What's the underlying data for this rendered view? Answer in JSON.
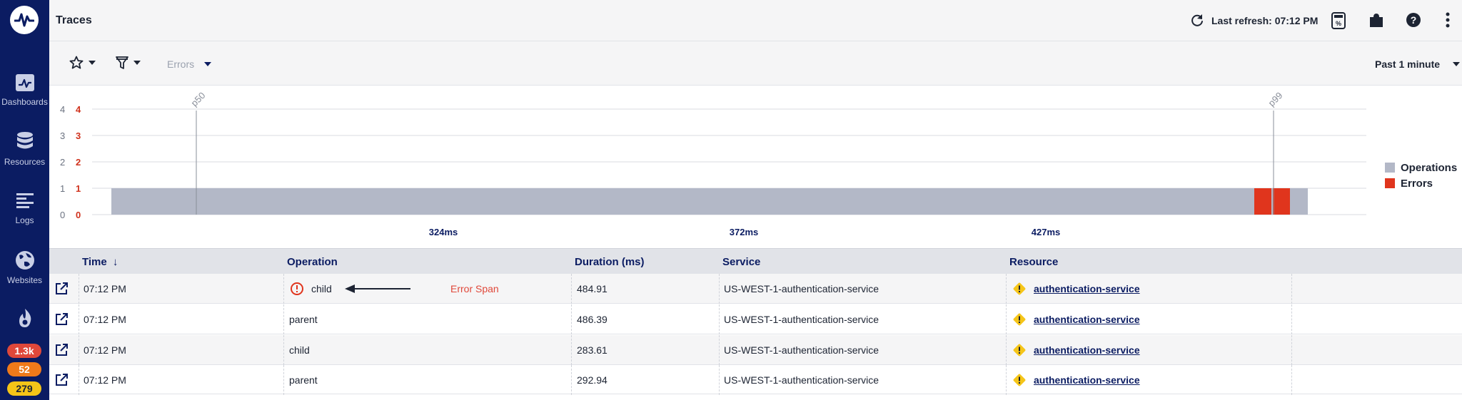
{
  "sidebar": {
    "items": [
      {
        "label": "Dashboards",
        "icon": "dashboard-icon"
      },
      {
        "label": "Resources",
        "icon": "database-icon"
      },
      {
        "label": "Logs",
        "icon": "logs-icon"
      },
      {
        "label": "Websites",
        "icon": "globe-icon"
      }
    ],
    "badges": [
      "1.3k",
      "52",
      "279"
    ]
  },
  "header": {
    "title": "Traces",
    "last_refresh": "Last refresh: 07:12 PM"
  },
  "toolbar": {
    "errors_placeholder": "Errors",
    "time_range": "Past 1 minute"
  },
  "colors": {
    "operations": "#b3b8c7",
    "errors": "#e0351d",
    "brand": "#0b1c62"
  },
  "chart_data": {
    "type": "bar",
    "series": [
      {
        "name": "Operations",
        "y_axis": "left"
      },
      {
        "name": "Errors",
        "y_axis": "right"
      }
    ],
    "y_ticks_left": [
      "0",
      "1",
      "2",
      "3",
      "4"
    ],
    "y_ticks_right": [
      "0",
      "1",
      "2",
      "3",
      "4"
    ],
    "ylim": [
      0,
      4
    ],
    "x_ticks": [
      "324ms",
      "372ms",
      "427ms"
    ],
    "markers": [
      "p50",
      "p99"
    ],
    "legend": [
      "Operations",
      "Errors"
    ],
    "legend_position": "right"
  },
  "table": {
    "columns": [
      "Time",
      "Operation",
      "Duration (ms)",
      "Service",
      "Resource"
    ],
    "sort_arrow": "↓",
    "rows": [
      {
        "time": "07:12 PM",
        "operation": "child",
        "duration": "484.91",
        "service": "US-WEST-1-authentication-service",
        "resource": "authentication-service",
        "error": true
      },
      {
        "time": "07:12 PM",
        "operation": "parent",
        "duration": "486.39",
        "service": "US-WEST-1-authentication-service",
        "resource": "authentication-service",
        "error": false
      },
      {
        "time": "07:12 PM",
        "operation": "child",
        "duration": "283.61",
        "service": "US-WEST-1-authentication-service",
        "resource": "authentication-service",
        "error": false
      },
      {
        "time": "07:12 PM",
        "operation": "parent",
        "duration": "292.94",
        "service": "US-WEST-1-authentication-service",
        "resource": "authentication-service",
        "error": false
      }
    ],
    "annotation": "Error Span"
  }
}
